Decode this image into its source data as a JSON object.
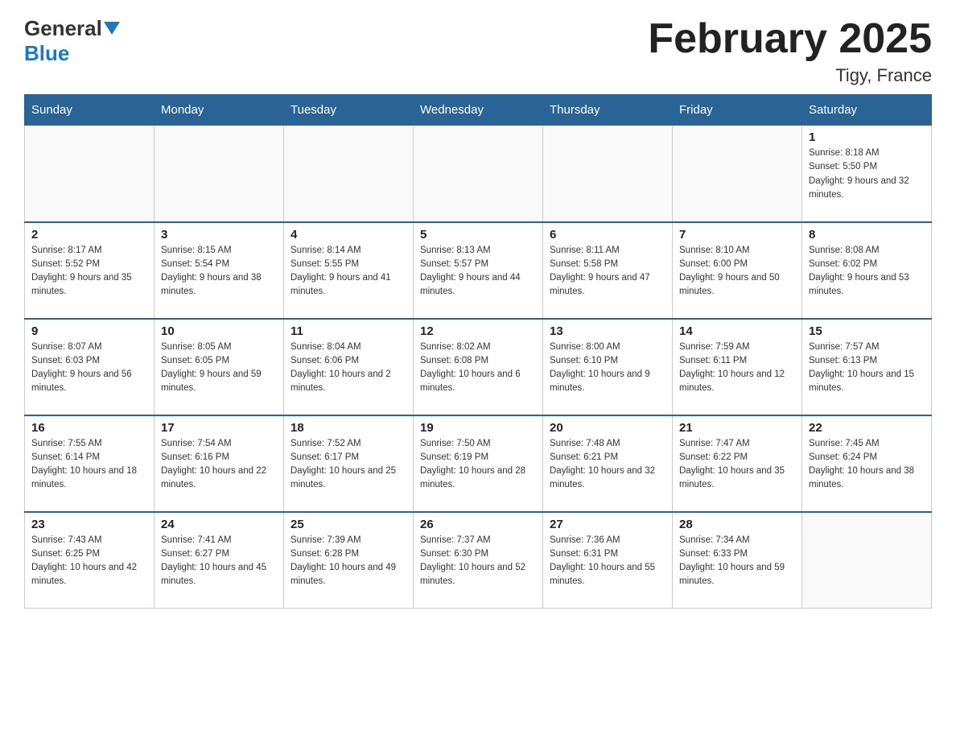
{
  "header": {
    "logo_general": "General",
    "logo_blue": "Blue",
    "month_title": "February 2025",
    "location": "Tigy, France"
  },
  "days_of_week": [
    "Sunday",
    "Monday",
    "Tuesday",
    "Wednesday",
    "Thursday",
    "Friday",
    "Saturday"
  ],
  "weeks": [
    {
      "days": [
        {
          "number": "",
          "sunrise": "",
          "sunset": "",
          "daylight": ""
        },
        {
          "number": "",
          "sunrise": "",
          "sunset": "",
          "daylight": ""
        },
        {
          "number": "",
          "sunrise": "",
          "sunset": "",
          "daylight": ""
        },
        {
          "number": "",
          "sunrise": "",
          "sunset": "",
          "daylight": ""
        },
        {
          "number": "",
          "sunrise": "",
          "sunset": "",
          "daylight": ""
        },
        {
          "number": "",
          "sunrise": "",
          "sunset": "",
          "daylight": ""
        },
        {
          "number": "1",
          "sunrise": "Sunrise: 8:18 AM",
          "sunset": "Sunset: 5:50 PM",
          "daylight": "Daylight: 9 hours and 32 minutes."
        }
      ]
    },
    {
      "days": [
        {
          "number": "2",
          "sunrise": "Sunrise: 8:17 AM",
          "sunset": "Sunset: 5:52 PM",
          "daylight": "Daylight: 9 hours and 35 minutes."
        },
        {
          "number": "3",
          "sunrise": "Sunrise: 8:15 AM",
          "sunset": "Sunset: 5:54 PM",
          "daylight": "Daylight: 9 hours and 38 minutes."
        },
        {
          "number": "4",
          "sunrise": "Sunrise: 8:14 AM",
          "sunset": "Sunset: 5:55 PM",
          "daylight": "Daylight: 9 hours and 41 minutes."
        },
        {
          "number": "5",
          "sunrise": "Sunrise: 8:13 AM",
          "sunset": "Sunset: 5:57 PM",
          "daylight": "Daylight: 9 hours and 44 minutes."
        },
        {
          "number": "6",
          "sunrise": "Sunrise: 8:11 AM",
          "sunset": "Sunset: 5:58 PM",
          "daylight": "Daylight: 9 hours and 47 minutes."
        },
        {
          "number": "7",
          "sunrise": "Sunrise: 8:10 AM",
          "sunset": "Sunset: 6:00 PM",
          "daylight": "Daylight: 9 hours and 50 minutes."
        },
        {
          "number": "8",
          "sunrise": "Sunrise: 8:08 AM",
          "sunset": "Sunset: 6:02 PM",
          "daylight": "Daylight: 9 hours and 53 minutes."
        }
      ]
    },
    {
      "days": [
        {
          "number": "9",
          "sunrise": "Sunrise: 8:07 AM",
          "sunset": "Sunset: 6:03 PM",
          "daylight": "Daylight: 9 hours and 56 minutes."
        },
        {
          "number": "10",
          "sunrise": "Sunrise: 8:05 AM",
          "sunset": "Sunset: 6:05 PM",
          "daylight": "Daylight: 9 hours and 59 minutes."
        },
        {
          "number": "11",
          "sunrise": "Sunrise: 8:04 AM",
          "sunset": "Sunset: 6:06 PM",
          "daylight": "Daylight: 10 hours and 2 minutes."
        },
        {
          "number": "12",
          "sunrise": "Sunrise: 8:02 AM",
          "sunset": "Sunset: 6:08 PM",
          "daylight": "Daylight: 10 hours and 6 minutes."
        },
        {
          "number": "13",
          "sunrise": "Sunrise: 8:00 AM",
          "sunset": "Sunset: 6:10 PM",
          "daylight": "Daylight: 10 hours and 9 minutes."
        },
        {
          "number": "14",
          "sunrise": "Sunrise: 7:59 AM",
          "sunset": "Sunset: 6:11 PM",
          "daylight": "Daylight: 10 hours and 12 minutes."
        },
        {
          "number": "15",
          "sunrise": "Sunrise: 7:57 AM",
          "sunset": "Sunset: 6:13 PM",
          "daylight": "Daylight: 10 hours and 15 minutes."
        }
      ]
    },
    {
      "days": [
        {
          "number": "16",
          "sunrise": "Sunrise: 7:55 AM",
          "sunset": "Sunset: 6:14 PM",
          "daylight": "Daylight: 10 hours and 18 minutes."
        },
        {
          "number": "17",
          "sunrise": "Sunrise: 7:54 AM",
          "sunset": "Sunset: 6:16 PM",
          "daylight": "Daylight: 10 hours and 22 minutes."
        },
        {
          "number": "18",
          "sunrise": "Sunrise: 7:52 AM",
          "sunset": "Sunset: 6:17 PM",
          "daylight": "Daylight: 10 hours and 25 minutes."
        },
        {
          "number": "19",
          "sunrise": "Sunrise: 7:50 AM",
          "sunset": "Sunset: 6:19 PM",
          "daylight": "Daylight: 10 hours and 28 minutes."
        },
        {
          "number": "20",
          "sunrise": "Sunrise: 7:48 AM",
          "sunset": "Sunset: 6:21 PM",
          "daylight": "Daylight: 10 hours and 32 minutes."
        },
        {
          "number": "21",
          "sunrise": "Sunrise: 7:47 AM",
          "sunset": "Sunset: 6:22 PM",
          "daylight": "Daylight: 10 hours and 35 minutes."
        },
        {
          "number": "22",
          "sunrise": "Sunrise: 7:45 AM",
          "sunset": "Sunset: 6:24 PM",
          "daylight": "Daylight: 10 hours and 38 minutes."
        }
      ]
    },
    {
      "days": [
        {
          "number": "23",
          "sunrise": "Sunrise: 7:43 AM",
          "sunset": "Sunset: 6:25 PM",
          "daylight": "Daylight: 10 hours and 42 minutes."
        },
        {
          "number": "24",
          "sunrise": "Sunrise: 7:41 AM",
          "sunset": "Sunset: 6:27 PM",
          "daylight": "Daylight: 10 hours and 45 minutes."
        },
        {
          "number": "25",
          "sunrise": "Sunrise: 7:39 AM",
          "sunset": "Sunset: 6:28 PM",
          "daylight": "Daylight: 10 hours and 49 minutes."
        },
        {
          "number": "26",
          "sunrise": "Sunrise: 7:37 AM",
          "sunset": "Sunset: 6:30 PM",
          "daylight": "Daylight: 10 hours and 52 minutes."
        },
        {
          "number": "27",
          "sunrise": "Sunrise: 7:36 AM",
          "sunset": "Sunset: 6:31 PM",
          "daylight": "Daylight: 10 hours and 55 minutes."
        },
        {
          "number": "28",
          "sunrise": "Sunrise: 7:34 AM",
          "sunset": "Sunset: 6:33 PM",
          "daylight": "Daylight: 10 hours and 59 minutes."
        },
        {
          "number": "",
          "sunrise": "",
          "sunset": "",
          "daylight": ""
        }
      ]
    }
  ]
}
